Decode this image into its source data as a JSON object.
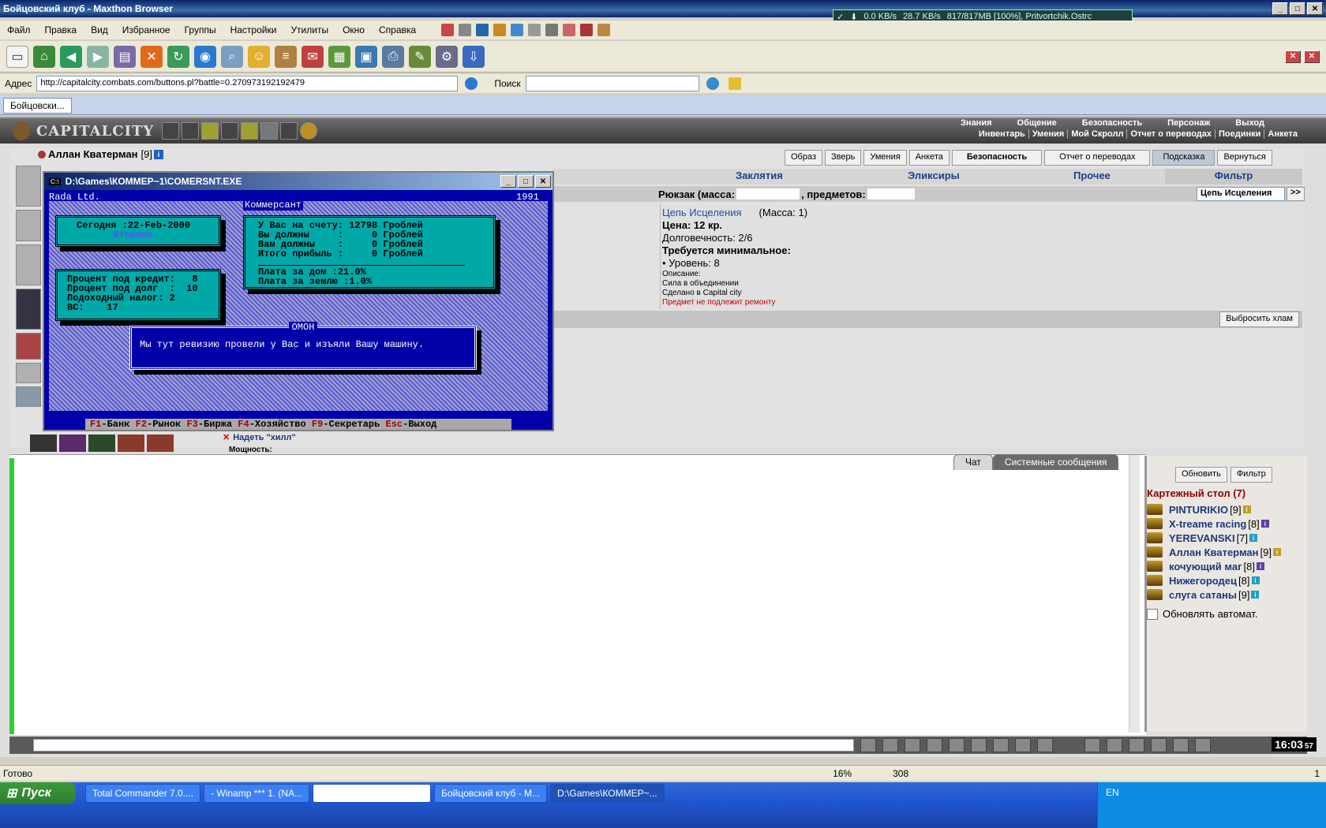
{
  "window": {
    "title": "Бойцовский клуб - Maxthon Browser"
  },
  "netmeter": {
    "down": "0.0 KB/s",
    "up": "28.7 KB/s",
    "info": "817/817MB [100%], Pritvortchik.Ostrc"
  },
  "menu": [
    "Файл",
    "Правка",
    "Вид",
    "Избранное",
    "Группы",
    "Настройки",
    "Утилиты",
    "Окно",
    "Справка"
  ],
  "address": {
    "label": "Адрес",
    "url": "http://capitalcity.combats.com/buttons.pl?battle=0.270973192192479",
    "search_label": "Поиск"
  },
  "tab": {
    "label": "Бойцовски..."
  },
  "game": {
    "logo": "CAPITALCITY",
    "nav_top": [
      "Знания",
      "Общение",
      "Безопасность",
      "Персонаж",
      "Выход"
    ],
    "nav_bottom": [
      "Инвентарь",
      "Умения",
      "Мой Скролл",
      "Отчет о переводах",
      "Поединки",
      "Анкета"
    ],
    "character": "Аллан Кватерман",
    "character_level": "[9]",
    "buttons": [
      "Образ",
      "Зверь",
      "Умения",
      "Анкета",
      "Безопасность",
      "Отчет о переводах",
      "Подсказка",
      "Вернуться"
    ],
    "categories": [
      "Заклятия",
      "Эликсиры",
      "Прочее",
      "Фильтр"
    ],
    "bag": "Рюкзак (масса:",
    "bag_items": ", предметов:",
    "filter_value": "Цепь Исцеления",
    "item": {
      "name": "Цепь Исцеления",
      "mass": "(Масса: 1)",
      "price": "Цена: 12 кр.",
      "durability": "Долговечность: 2/6",
      "req_title": "Требуется минимальное:",
      "req_level": "• Уровень: 8",
      "desc_title": "Описание:",
      "desc1": "Сила в объединении",
      "desc2": "Сделано в Capital city",
      "note": "Предмет не подлежит ремонту"
    },
    "throw_button": "Выбросить хлам",
    "wear_link": "Надеть \"хилл\"",
    "power_label": "Мощность:"
  },
  "dos": {
    "title": "D:\\Games\\КОММЕР~1\\COMERSNT.EXE",
    "company": "Rada Ltd.",
    "year": "1991",
    "app_name": "Коммерсант",
    "date_line": "Сегодня :22-Feb-2000",
    "weekday": "Вторник",
    "account": [
      "У Вас на счету: 12798 Гроблей",
      "Вы должны     :     0 Гроблей",
      "Вам должны    :     0 Гроблей",
      "Итого прибыль :     0 Гроблей"
    ],
    "fees": [
      "Плата за дом :21.0%",
      "Плата за землю :1.0%"
    ],
    "rates": [
      "Процент под кредит:   8",
      "Процент под долг  :  10",
      "Подоходный налог: 2",
      "ВС:    17"
    ],
    "popup_title": "ОМОН",
    "popup_text": "Мы тут ревизию провели у Вас и изъяли Вашу машину.",
    "keys": [
      {
        "k": "F1",
        "l": "-Банк"
      },
      {
        "k": "F2",
        "l": "-Рынок"
      },
      {
        "k": "F3",
        "l": "-Биржа"
      },
      {
        "k": "F4",
        "l": "-Хозяйство"
      },
      {
        "k": "F9",
        "l": "-Секретарь"
      },
      {
        "k": "Esc",
        "l": "-Выход"
      }
    ]
  },
  "chat": {
    "tabs": [
      "Чат",
      "Системные сообщения"
    ]
  },
  "room": {
    "refresh": "Обновить",
    "filter": "Фильтр",
    "title": "Картежный стол (7)",
    "players": [
      {
        "name": "PINTURIKIO",
        "lvl": "[9]"
      },
      {
        "name": "X-treame racing",
        "lvl": "[8]"
      },
      {
        "name": "YEREVANSKI",
        "lvl": "[7]"
      },
      {
        "name": "Аллан Кватерман",
        "lvl": "[9]"
      },
      {
        "name": "кочующий маг",
        "lvl": "[8]"
      },
      {
        "name": "Нижегородец",
        "lvl": "[8]"
      },
      {
        "name": "слуга сатаны",
        "lvl": "[9]"
      }
    ],
    "auto_refresh": "Обновлять автомат."
  },
  "clock": "16:03",
  "clock_sec": "57",
  "status": {
    "text": "Готово",
    "zoom": "16%",
    "count": "308",
    "page": "1"
  },
  "taskbar": {
    "start": "Пуск",
    "tasks": [
      "Total Commander 7.0....",
      "- Winamp *** 1. (NA...",
      "Бойцовский клуб - M...",
      "D:\\Games\\КОММЕР~..."
    ],
    "lang": "EN"
  }
}
